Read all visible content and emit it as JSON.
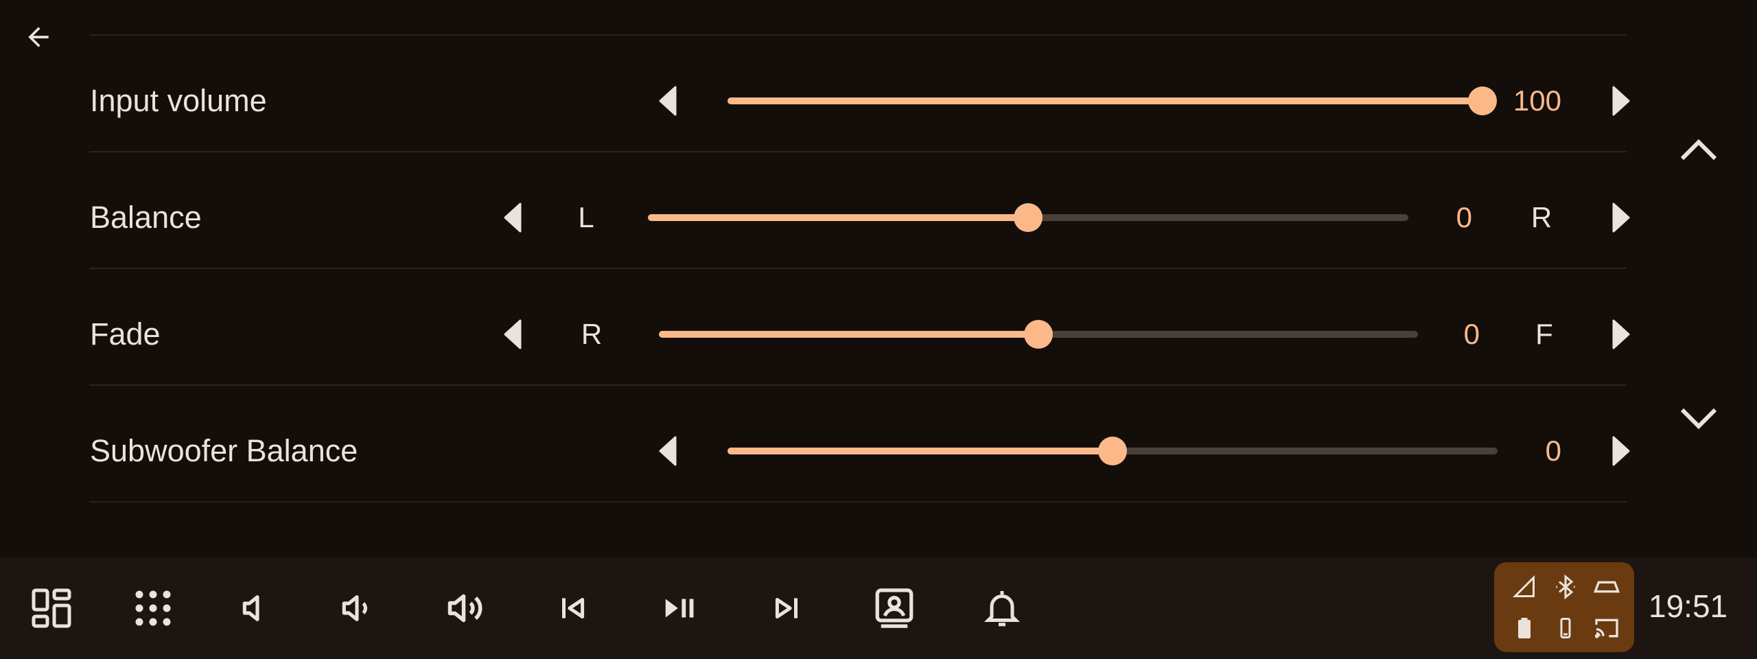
{
  "colors": {
    "accent": "#fbb98a",
    "background": "#140e0b",
    "text": "#ece2dc",
    "track": "#4a403a",
    "status_panel": "#6a3a10"
  },
  "header": {
    "back_icon": "arrow-left-icon"
  },
  "sliders": [
    {
      "label": "Input volume",
      "value": "100",
      "level": 1.0,
      "left_label": "",
      "right_label": ""
    },
    {
      "label": "Balance",
      "value": "0",
      "level": 0.5,
      "left_label": "L",
      "right_label": "R"
    },
    {
      "label": "Fade",
      "value": "0",
      "level": 0.5,
      "left_label": "R",
      "right_label": "F"
    },
    {
      "label": "Subwoofer Balance",
      "value": "0",
      "level": 0.5,
      "left_label": "",
      "right_label": ""
    }
  ],
  "scroll": {
    "up_icon": "chevron-up-icon",
    "down_icon": "chevron-down-icon"
  },
  "navbar": {
    "buttons": [
      "dashboard-icon",
      "app-grid-icon",
      "volume-mute-icon",
      "volume-down-icon",
      "volume-up-icon",
      "skip-previous-icon",
      "play-pause-icon",
      "skip-next-icon",
      "assistant-icon",
      "notification-bell-icon"
    ],
    "status_icons": [
      "cellular-signal-icon",
      "bluetooth-icon",
      "car-icon",
      "battery-icon",
      "phone-icon",
      "cast-icon"
    ],
    "clock": "19:51"
  }
}
